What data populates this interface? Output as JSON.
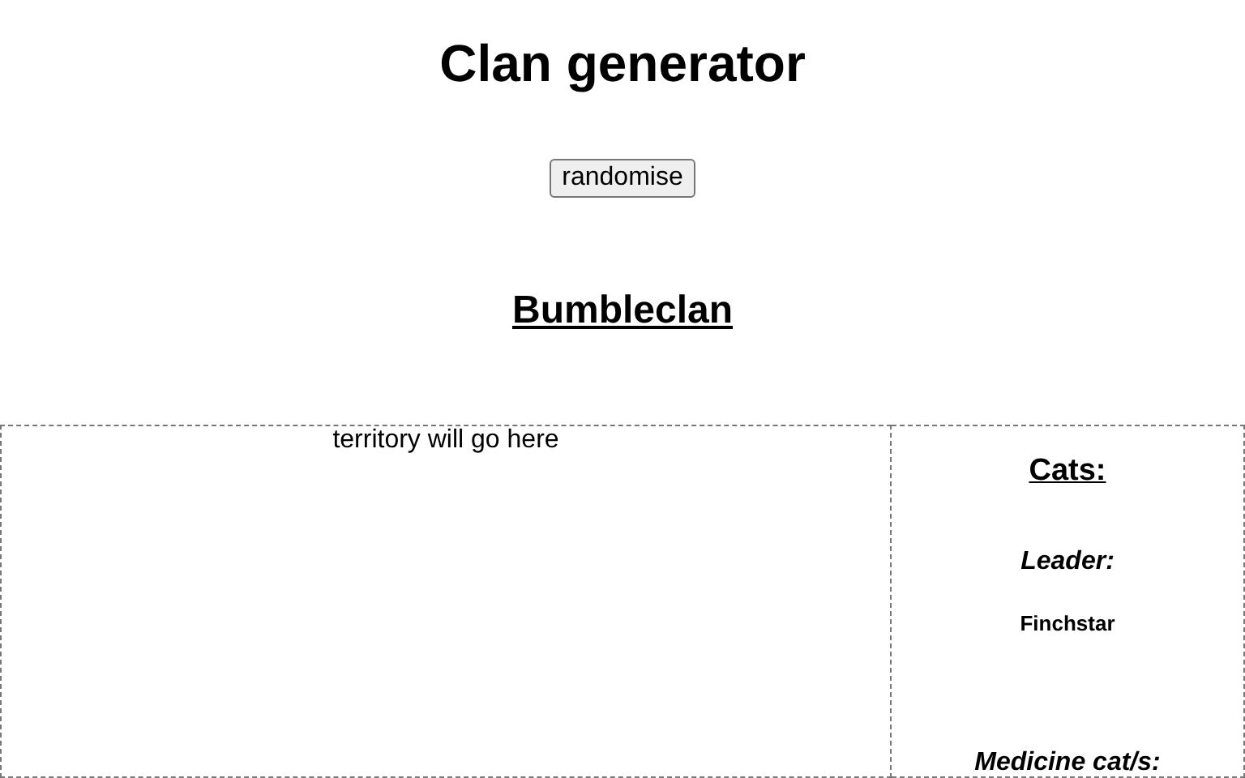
{
  "title": "Clan generator",
  "button": "randomise",
  "clan_name": "Bumbleclan",
  "territory": "territory will go here",
  "cats": {
    "heading": "Cats:",
    "sections": [
      {
        "heading": "Leader:",
        "names": [
          "Finchstar"
        ]
      },
      {
        "heading": "Medicine cat/s:"
      }
    ]
  }
}
